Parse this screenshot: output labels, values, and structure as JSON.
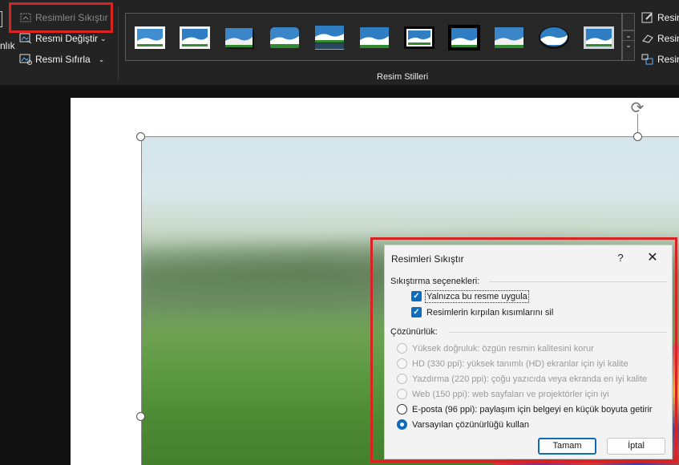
{
  "ribbon": {
    "cut_label": "nlık",
    "compress_label": "Resimleri Sıkıştır",
    "change_picture_label": "Resmi Değiştir",
    "reset_picture_label": "Resmi Sıfırla",
    "group_label": "Resim Stilleri",
    "right_items": [
      "Resim",
      "Resim",
      "Resim"
    ],
    "style_thumbs": [
      "simple-frame",
      "soft-edge",
      "drop-shadow",
      "rounded",
      "reflected",
      "soft-shadow",
      "thick-black-frame",
      "black-border",
      "bevel",
      "oval",
      "metal-frame"
    ]
  },
  "dialog": {
    "title": "Resimleri Sıkıştır",
    "help": "?",
    "close": "✕",
    "compression_header": "Sıkıştırma seçenekleri:",
    "options": [
      {
        "label": "Yalnızca bu resme uygula",
        "checked": true
      },
      {
        "label": "Resimlerin kırpılan kısımlarını sil",
        "checked": true
      }
    ],
    "resolution_header": "Çözünürlük:",
    "resolutions": [
      {
        "label": "Yüksek doğruluk: özgün resmin kalitesini korur",
        "enabled": false,
        "selected": false
      },
      {
        "label": "HD (330 ppi): yüksek tanımlı (HD) ekranlar için iyi kalite",
        "enabled": false,
        "selected": false
      },
      {
        "label": "Yazdırma (220 ppi): çoğu yazıcıda veya ekranda en iyi kalite",
        "enabled": false,
        "selected": false
      },
      {
        "label": "Web (150 ppi): web sayfaları ve projektörler için iyi",
        "enabled": false,
        "selected": false
      },
      {
        "label": "E-posta (96 ppi): paylaşım için belgeyi en küçük boyuta getirir",
        "enabled": true,
        "selected": false
      },
      {
        "label": "Varsayılan çözünürlüğü kullan",
        "enabled": true,
        "selected": true
      }
    ],
    "ok_label": "Tamam",
    "cancel_label": "İptal"
  },
  "colors": {
    "accent": "#0f6cbd",
    "highlight": "#d92323",
    "ribbon_bg": "#232323"
  }
}
